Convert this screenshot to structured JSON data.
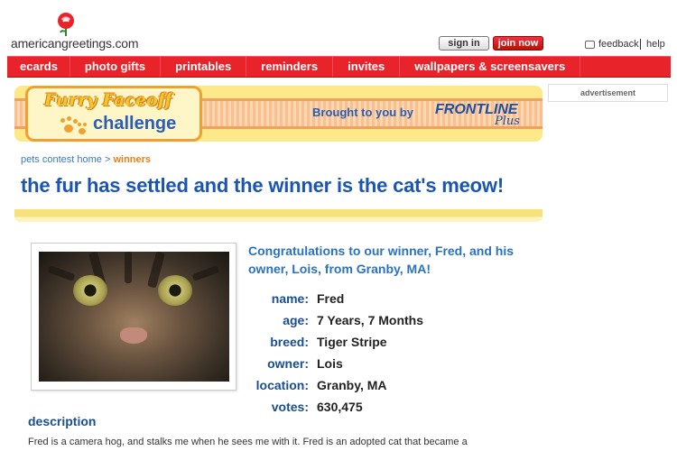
{
  "header": {
    "site_name": "americangreetings.com",
    "signin_label": "sign in",
    "join_label": "join now",
    "feedback_label": "feedback",
    "help_label": "help"
  },
  "nav": {
    "items": [
      {
        "label": "ecards"
      },
      {
        "label": "photo gifts"
      },
      {
        "label": "printables"
      },
      {
        "label": "reminders"
      },
      {
        "label": "invites"
      },
      {
        "label": "wallpapers & screensavers"
      }
    ]
  },
  "banner": {
    "title": "Furry Faceoff",
    "subtitle": "challenge",
    "sponsor_text": "Brought to you by",
    "sponsor_name": "FRONTLINE",
    "sponsor_suffix": "Plus"
  },
  "ad_label": "advertisement",
  "breadcrumb": {
    "home": "pets contest home",
    "separator": ">",
    "current": "winners"
  },
  "headline": "the fur has settled and the winner is the cat's meow!",
  "winner": {
    "congrats": "Congratulations to our winner, Fred, and his owner, Lois, from Granby, MA!",
    "fields": [
      {
        "label": "name:",
        "value": "Fred"
      },
      {
        "label": "age:",
        "value": "7 Years, 7 Months"
      },
      {
        "label": "breed:",
        "value": "Tiger Stripe"
      },
      {
        "label": "owner:",
        "value": "Lois"
      },
      {
        "label": "location:",
        "value": "Granby, MA"
      },
      {
        "label": "votes:",
        "value": "630,475"
      }
    ]
  },
  "description": {
    "heading": "description",
    "text": "Fred is a camera hog, and stalks me when he sees me with it. Fred is an adopted cat that became a"
  },
  "colors": {
    "nav_red": "#e8242a",
    "headline_blue": "#1a55b5",
    "accent_orange": "#e8801a"
  }
}
